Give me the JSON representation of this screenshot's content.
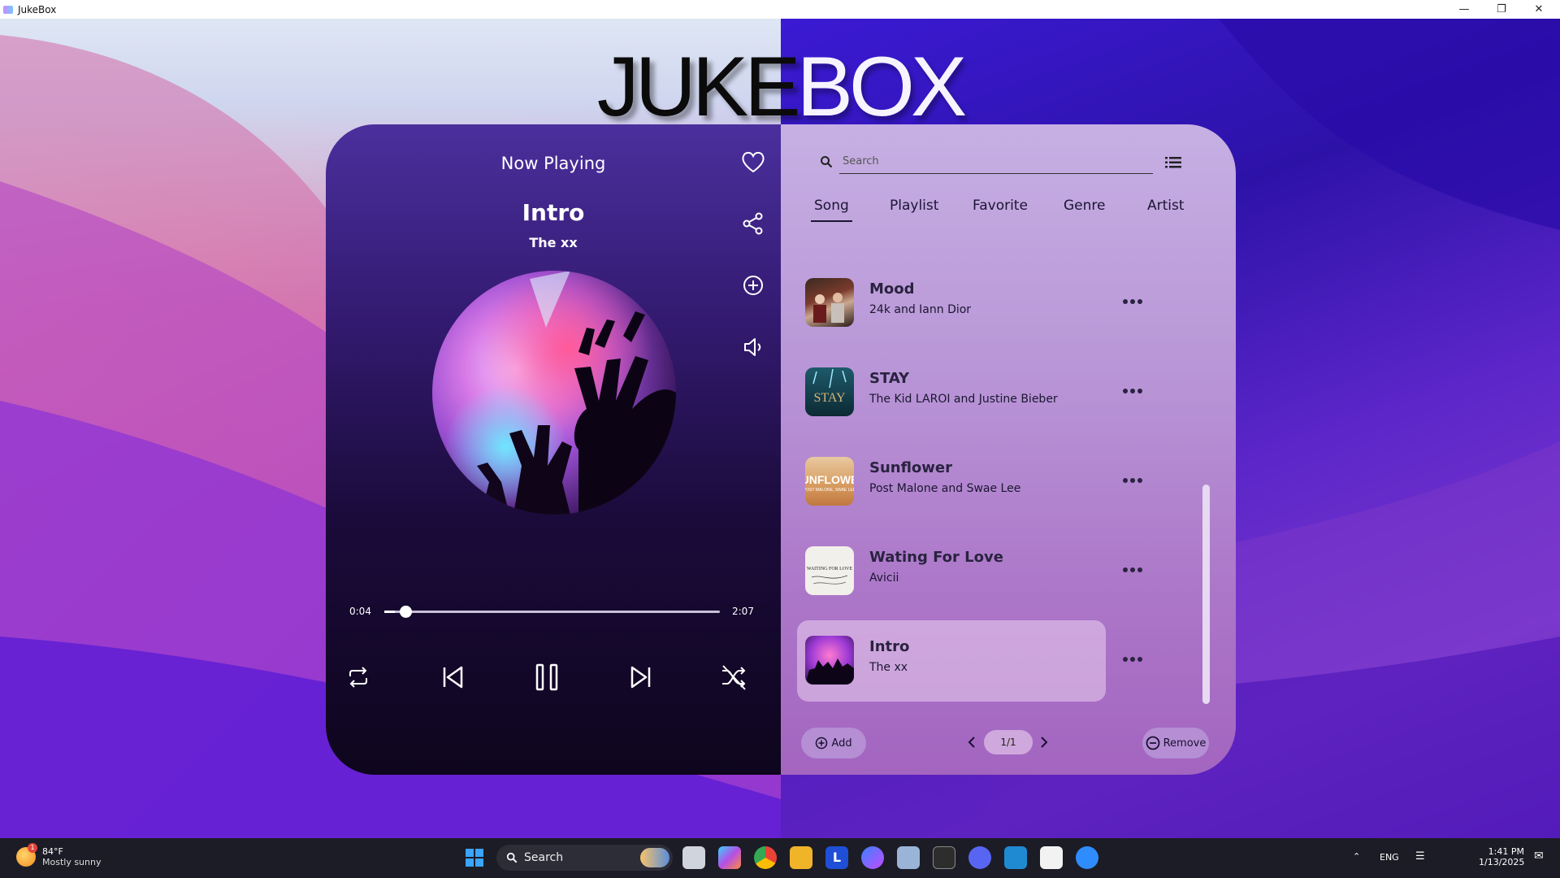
{
  "window": {
    "title": "JukeBox"
  },
  "header": {
    "title_left": "JUKE",
    "title_right": "BOX"
  },
  "player": {
    "section_label": "Now Playing",
    "song_title": "Intro",
    "artist": "The xx",
    "elapsed": "0:04",
    "duration": "2:07",
    "progress_fraction": 0.032
  },
  "library": {
    "search_placeholder": "Search",
    "tabs": [
      "Song",
      "Playlist",
      "Favorite",
      "Genre",
      "Artist"
    ],
    "active_tab": "Song",
    "songs": [
      {
        "title": "Mood",
        "artist": "24k and Iann Dior"
      },
      {
        "title": "STAY",
        "artist": "The Kid LAROI and Justine Bieber"
      },
      {
        "title": "Sunflower",
        "artist": "Post Malone and Swae Lee"
      },
      {
        "title": "Wating For Love",
        "artist": "Avicii"
      },
      {
        "title": "Intro",
        "artist": "The xx",
        "selected": true
      }
    ],
    "add_label": "Add",
    "remove_label": "Remove",
    "page_indicator": "1/1"
  },
  "taskbar": {
    "weather_temp": "84°F",
    "weather_desc": "Mostly sunny",
    "weather_badge": "1",
    "search_label": "Search",
    "language": "ENG",
    "time": "1:41 PM",
    "date": "1/13/2025"
  },
  "colors": {
    "accent": "#2b0a7a",
    "selected_row": "#e0c7ea"
  }
}
